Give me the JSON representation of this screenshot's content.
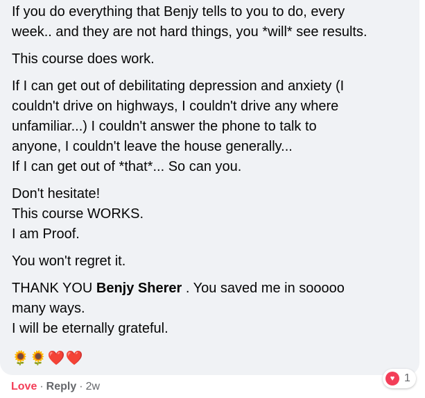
{
  "comment": {
    "paragraphs": [
      [
        "If you do everything that Benjy tells to you to do, every",
        "week.. and they are not hard things, you *will* see results."
      ],
      [
        "This course does work."
      ],
      [
        "If I can get out of debilitating depression and anxiety (I",
        "couldn't drive on highways, I couldn't drive any where",
        "unfamiliar...) I couldn't answer the phone to talk to",
        "anyone, I couldn't leave the house generally...",
        "If I can get out of *that*... So can you."
      ],
      [
        "Don't hesitate!",
        "This course WORKS.",
        "I am Proof."
      ],
      [
        "You won't regret it."
      ]
    ],
    "thanks": {
      "prefix": "THANK YOU ",
      "mention": "Benjy Sherer",
      "suffix": " . You saved me in sooooo",
      "line2": "many ways.",
      "line3": "I will be eternally grateful."
    },
    "emojis": "🌻🌻❤️❤️"
  },
  "actions": {
    "love": "Love",
    "separator": "·",
    "reply": "Reply",
    "time": "2w"
  },
  "reaction": {
    "icon": "heart-reaction-icon",
    "count": "1",
    "color": "#f33e58"
  }
}
